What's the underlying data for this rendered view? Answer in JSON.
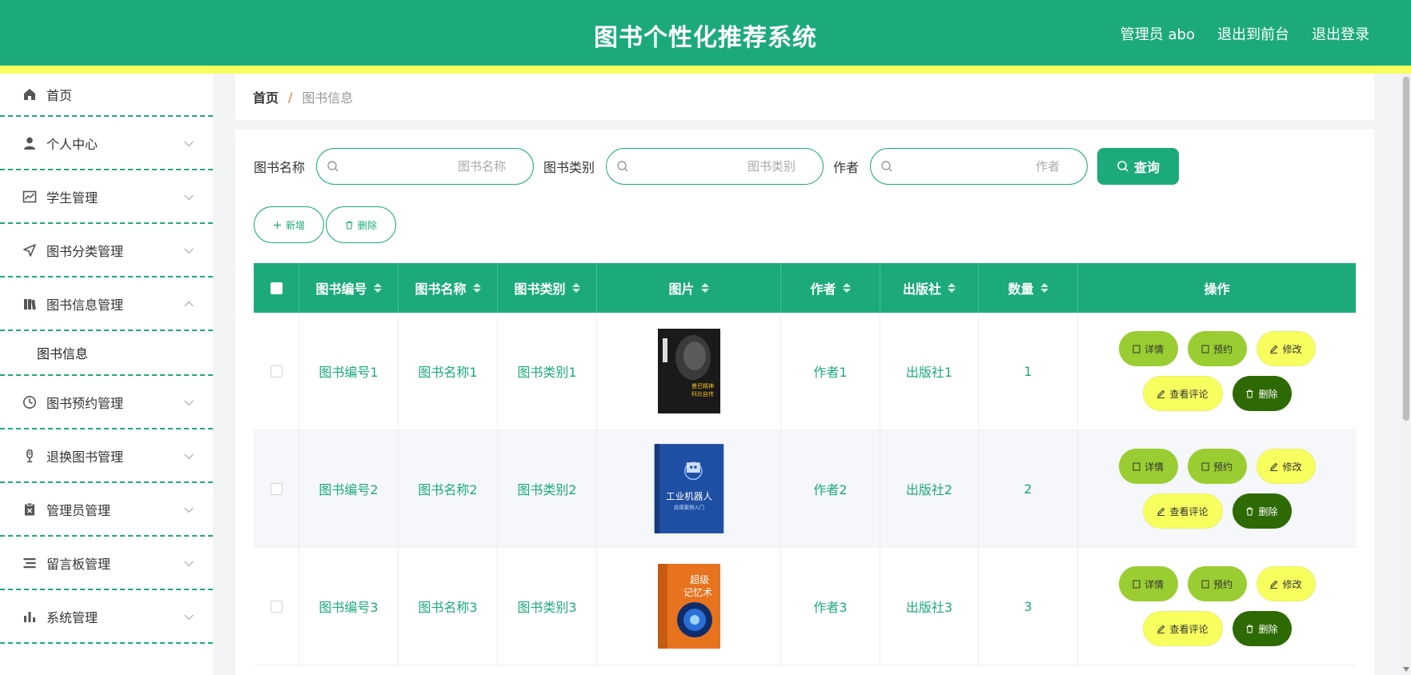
{
  "header": {
    "title": "图书个性化推荐系统",
    "admin_label": "管理员 abo",
    "to_front_label": "退出到前台",
    "logout_label": "退出登录"
  },
  "colors": {
    "primary": "#1caa7b",
    "accent_yellow": "#f7ff5e",
    "lime": "#9acd32",
    "dark_green": "#2d6a03"
  },
  "sidebar": {
    "items": [
      {
        "label": "首页",
        "icon": "home-icon"
      },
      {
        "label": "个人中心",
        "icon": "user-icon"
      },
      {
        "label": "学生管理",
        "icon": "chart-icon"
      },
      {
        "label": "图书分类管理",
        "icon": "send-icon"
      },
      {
        "label": "图书信息管理",
        "icon": "book-icon"
      },
      {
        "label": "图书信息",
        "icon": ""
      },
      {
        "label": "图书预约管理",
        "icon": "clock-icon"
      },
      {
        "label": "退换图书管理",
        "icon": "microphone-icon"
      },
      {
        "label": "管理员管理",
        "icon": "clipboard-icon"
      },
      {
        "label": "留言板管理",
        "icon": "list-icon"
      },
      {
        "label": "系统管理",
        "icon": "bar-chart-icon"
      }
    ]
  },
  "breadcrumb": {
    "home": "首页",
    "separator": "/",
    "current": "图书信息"
  },
  "search": {
    "name_label": "图书名称",
    "name_placeholder": "图书名称",
    "category_label": "图书类别",
    "category_placeholder": "图书类别",
    "author_label": "作者",
    "author_placeholder": "作者",
    "query_button": "查询"
  },
  "actions": {
    "add_label": "新增",
    "delete_label": "删除"
  },
  "table": {
    "columns": [
      "图书编号",
      "图书名称",
      "图书类别",
      "图片",
      "作者",
      "出版社",
      "数量",
      "操作"
    ],
    "rows": [
      {
        "code": "图书编号1",
        "name": "图书名称1",
        "category": "图书类别1",
        "cover": "book-cover-dark",
        "author": "作者1",
        "publisher": "出版社1",
        "quantity": "1"
      },
      {
        "code": "图书编号2",
        "name": "图书名称2",
        "category": "图书类别2",
        "cover": "book-cover-robot",
        "author": "作者2",
        "publisher": "出版社2",
        "quantity": "2"
      },
      {
        "code": "图书编号3",
        "name": "图书名称3",
        "category": "图书类别3",
        "cover": "book-cover-memory",
        "author": "作者3",
        "publisher": "出版社3",
        "quantity": "3"
      }
    ],
    "ops": {
      "detail": "详情",
      "reserve": "预约",
      "edit": "修改",
      "comment": "查看评论",
      "delete": "删除"
    }
  },
  "covers": {
    "cover1": {
      "line1": "曼巴精神",
      "line2": "科比自传"
    },
    "cover2": {
      "line1": "工业机器人",
      "line2": "应用案例入门"
    },
    "cover3": {
      "line1": "超级",
      "line2": "记忆术"
    }
  }
}
